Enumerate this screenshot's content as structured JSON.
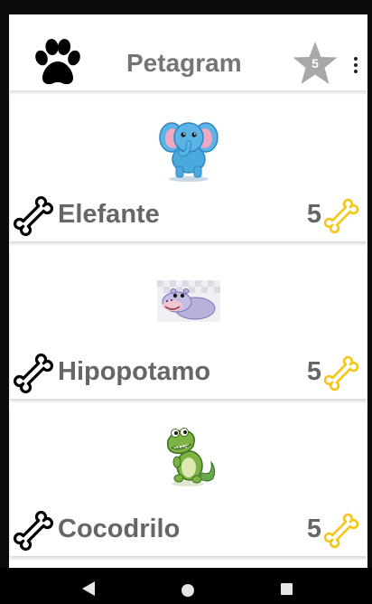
{
  "app": {
    "title": "Petagram",
    "favorites_count": "5"
  },
  "pets": [
    {
      "name": "Elefante",
      "rating": "5",
      "image": "elephant-cartoon"
    },
    {
      "name": "Hipopotamo",
      "rating": "5",
      "image": "hippo-cartoon"
    },
    {
      "name": "Cocodrilo",
      "rating": "5",
      "image": "crocodile-cartoon"
    }
  ],
  "icons": {
    "logo": "paw-icon",
    "favorites": "star-icon",
    "menu": "more-vert-icon",
    "like": "bone-outline-icon",
    "rating": "bone-yellow-icon"
  },
  "colors": {
    "star": "#a8a8a8",
    "rating_bone": "#f5c518",
    "text": "#6a6a6a"
  }
}
